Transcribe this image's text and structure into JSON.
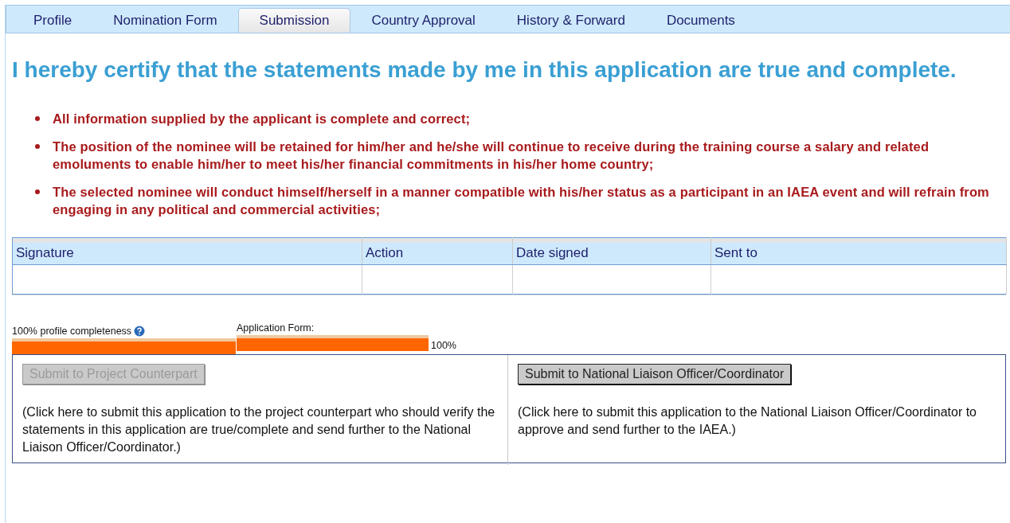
{
  "tabs": [
    {
      "label": "Profile",
      "selected": false
    },
    {
      "label": "Nomination Form",
      "selected": false
    },
    {
      "label": "Submission",
      "selected": true
    },
    {
      "label": "Country Approval",
      "selected": false
    },
    {
      "label": "History & Forward",
      "selected": false
    },
    {
      "label": "Documents",
      "selected": false
    }
  ],
  "heading": "I hereby certify that the statements made by me in this application are true and complete.",
  "statements": [
    "All information supplied by the applicant is complete and correct;",
    "The position of the nominee will be retained for him/her and he/she will continue to receive during the training course a salary and related emoluments to enable him/her to meet his/her financial commitments in his/her home country;",
    "The selected nominee will conduct himself/herself in a manner compatible with his/her status as a participant in an IAEA event and will refrain from engaging in any political and commercial activities;"
  ],
  "signature_table": {
    "columns": [
      "Signature",
      "Action",
      "Date signed",
      "Sent to"
    ]
  },
  "profile_progress": {
    "label": "100% profile completeness",
    "level": 1
  },
  "application_progress": {
    "label": "Application Form:",
    "level": 1,
    "reading": "100%"
  },
  "submit_panels": [
    {
      "button": "Submit to Project Counterpart",
      "disabled": true,
      "note": "(Click here to submit this application to the project counterpart who should verify the statements in this application are true/complete and send further to the National Liaison Officer/Coordinator.)"
    },
    {
      "button": "Submit to National Liaison Officer/Coordinator",
      "disabled": false,
      "note": "(Click here to submit this application to the National Liaison Officer/Coordinator to approve and send further to the IAEA.)"
    }
  ]
}
